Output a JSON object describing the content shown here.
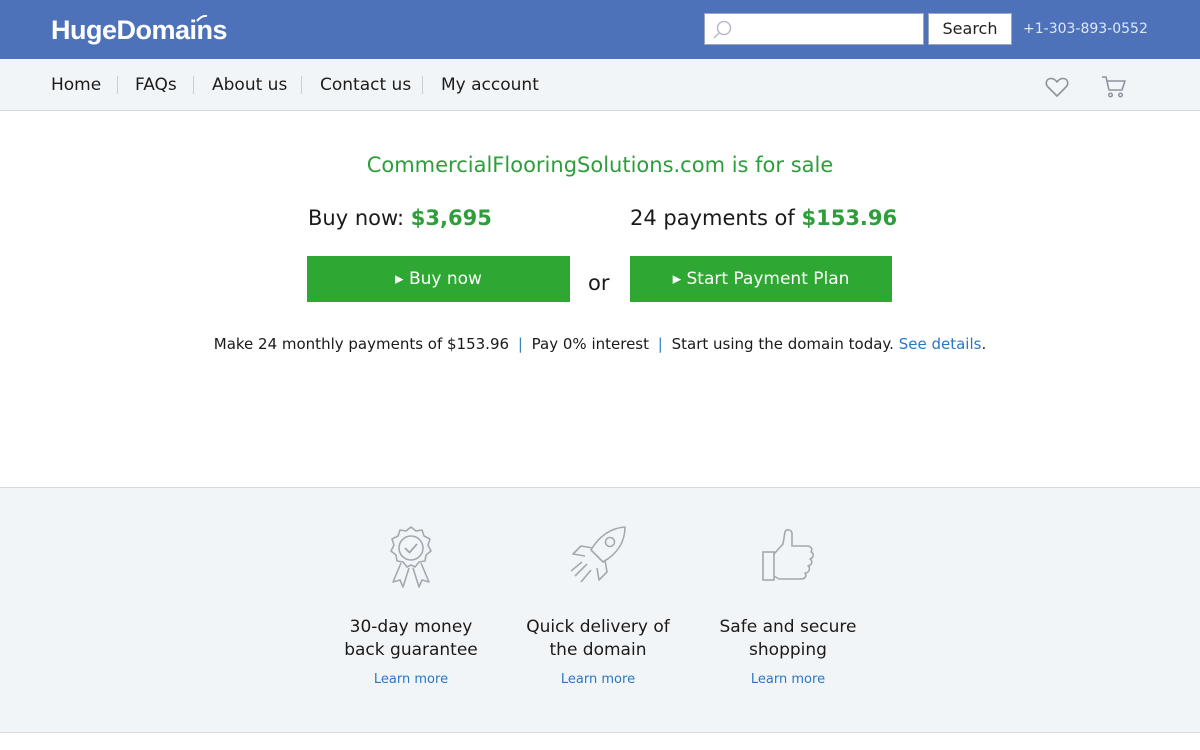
{
  "header": {
    "logo": "HugeDomains",
    "search": {
      "placeholder": "",
      "button_label": "Search"
    },
    "phone": "+1-303-893-0552"
  },
  "nav": {
    "items": [
      "Home",
      "FAQs",
      "About us",
      "Contact us",
      "My account"
    ],
    "icons": [
      "heart-icon",
      "cart-icon"
    ]
  },
  "listing": {
    "headline": "CommercialFlooringSolutions.com is for sale",
    "buy_label": "Buy now: ",
    "buy_price": "$3,695",
    "payments_label": "24 payments of ",
    "payment_amount": "$153.96",
    "buy_button": "▸ Buy now",
    "or": "or",
    "plan_button": "▸ Start Payment Plan",
    "details": {
      "part1": "Make 24 monthly payments of $153.96",
      "sep": "|",
      "part2": "Pay 0% interest",
      "part3": "Start using the domain today.",
      "link": "See details",
      "end": "."
    }
  },
  "features": [
    {
      "icon": "award-ribbon-icon",
      "title_line1": "30-day money",
      "title_line2": "back guarantee",
      "link": "Learn more"
    },
    {
      "icon": "rocket-icon",
      "title_line1": "Quick delivery of",
      "title_line2": "the domain",
      "link": "Learn more"
    },
    {
      "icon": "thumbs-up-icon",
      "title_line1": "Safe and secure",
      "title_line2": "shopping",
      "link": "Learn more"
    }
  ],
  "colors": {
    "header_bg": "#4d72b9",
    "accent_green": "#2ea832",
    "headline_green": "#2e9e3a",
    "link_blue": "#2a78c4",
    "nav_bg": "#f2f5f8"
  }
}
